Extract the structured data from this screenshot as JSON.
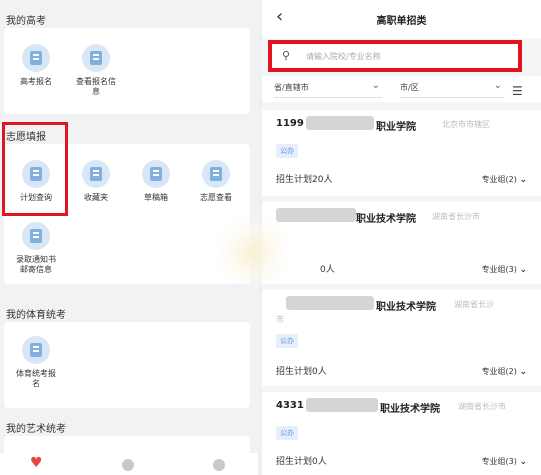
{
  "left": {
    "my_gaokao": {
      "title": "我的高考",
      "tiles": [
        {
          "label": "高考报名",
          "icon": "document-icon"
        },
        {
          "label": "查看报名信息",
          "icon": "info-icon"
        }
      ]
    },
    "volunteer": {
      "title": "志愿填报",
      "tiles": [
        {
          "label": "计划查询",
          "icon": "plan-icon"
        },
        {
          "label": "收藏夹",
          "icon": "favorites-icon"
        },
        {
          "label": "草稿箱",
          "icon": "draft-icon"
        },
        {
          "label": "志愿查看",
          "icon": "view-icon"
        },
        {
          "label": "录取通知书邮寄信息",
          "icon": "mail-icon"
        }
      ]
    },
    "pe_exam": {
      "title": "我的体育统考",
      "tiles": [
        {
          "label": "体育统考报名",
          "icon": "sports-icon"
        }
      ]
    },
    "art_exam": {
      "title": "我的艺术统考"
    }
  },
  "right": {
    "nav_title": "高职单招类",
    "search_placeholder": "请输入院校/专业名称",
    "filter_province": "省/直辖市",
    "filter_city": "市/区",
    "items": [
      {
        "code": "1199",
        "name_suffix": "职业学院",
        "location": "北京市市辖区",
        "badge": "公办",
        "plan": "招生计划20人",
        "group": "专业组(2)"
      },
      {
        "code": "",
        "name_suffix": "职业技术学院",
        "location": "湖南省长沙市",
        "badge": "",
        "plan": "0人",
        "group": "专业组(3)"
      },
      {
        "code": "",
        "name_suffix": "职业技术学院",
        "location": "湖南省长沙",
        "location2": "市",
        "badge": "公办",
        "plan": "招生计划0人",
        "group": "专业组(2)"
      },
      {
        "code": "4331",
        "name_suffix": "职业技术学院",
        "location": "湖南省长沙市",
        "badge": "公办",
        "plan": "招生计划0人",
        "group": "专业组(3)"
      }
    ]
  },
  "colors": {
    "highlight": "#e0151f",
    "accent": "#5b8fd6",
    "heart": "#e8443f"
  }
}
